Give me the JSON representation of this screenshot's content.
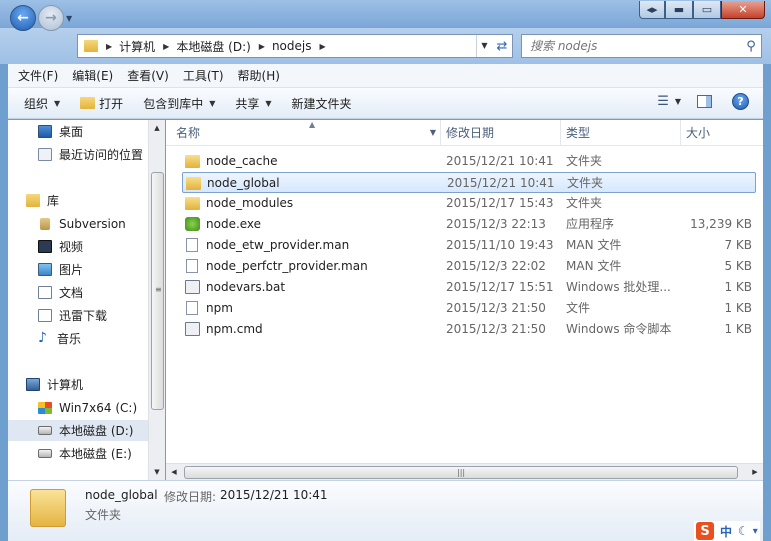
{
  "window": {
    "restore_label": "◂▸",
    "minimize_label": "▬",
    "maximize_label": "▭",
    "close_label": "✕"
  },
  "address": {
    "breadcrumbs": [
      "计算机",
      "本地磁盘 (D:)",
      "nodejs"
    ]
  },
  "search": {
    "placeholder": "搜索 nodejs"
  },
  "menu": [
    "文件(F)",
    "编辑(E)",
    "查看(V)",
    "工具(T)",
    "帮助(H)"
  ],
  "toolbar": {
    "organize": "组织",
    "open": "打开",
    "include_library": "包含到库中",
    "share": "共享",
    "new_folder": "新建文件夹"
  },
  "nav": {
    "favorites": [
      {
        "label": "桌面",
        "icon": "desktop-icon"
      },
      {
        "label": "最近访问的位置",
        "icon": "recent-places-icon"
      }
    ],
    "libraries_label": "库",
    "libraries": [
      {
        "label": "Subversion",
        "icon": "subversion-icon"
      },
      {
        "label": "视频",
        "icon": "video-icon"
      },
      {
        "label": "图片",
        "icon": "pictures-icon"
      },
      {
        "label": "文档",
        "icon": "documents-icon"
      },
      {
        "label": "迅雷下载",
        "icon": "thunder-download-icon"
      },
      {
        "label": "音乐",
        "icon": "music-icon"
      }
    ],
    "computer_label": "计算机",
    "drives": [
      {
        "label": "Win7x64 (C:)",
        "icon": "windows-drive-icon"
      },
      {
        "label": "本地磁盘 (D:)",
        "icon": "drive-icon",
        "selected": true
      },
      {
        "label": "本地磁盘 (E:)",
        "icon": "drive-icon"
      }
    ]
  },
  "columns": {
    "name": "名称",
    "modified": "修改日期",
    "type": "类型",
    "size": "大小"
  },
  "files": [
    {
      "name": "node_cache",
      "modified": "2015/12/21 10:41",
      "type": "文件夹",
      "size": "",
      "kind": "folder"
    },
    {
      "name": "node_global",
      "modified": "2015/12/21 10:41",
      "type": "文件夹",
      "size": "",
      "kind": "folder",
      "selected": true
    },
    {
      "name": "node_modules",
      "modified": "2015/12/17 15:43",
      "type": "文件夹",
      "size": "",
      "kind": "folder"
    },
    {
      "name": "node.exe",
      "modified": "2015/12/3 22:13",
      "type": "应用程序",
      "size": "13,239 KB",
      "kind": "exe"
    },
    {
      "name": "node_etw_provider.man",
      "modified": "2015/11/10 19:43",
      "type": "MAN 文件",
      "size": "7 KB",
      "kind": "file"
    },
    {
      "name": "node_perfctr_provider.man",
      "modified": "2015/12/3 22:02",
      "type": "MAN 文件",
      "size": "5 KB",
      "kind": "file"
    },
    {
      "name": "nodevars.bat",
      "modified": "2015/12/17 15:51",
      "type": "Windows 批处理...",
      "size": "1 KB",
      "kind": "bat"
    },
    {
      "name": "npm",
      "modified": "2015/12/3 21:50",
      "type": "文件",
      "size": "1 KB",
      "kind": "file"
    },
    {
      "name": "npm.cmd",
      "modified": "2015/12/3 21:50",
      "type": "Windows 命令脚本",
      "size": "1 KB",
      "kind": "bat"
    }
  ],
  "details": {
    "name": "node_global",
    "modified_label": "修改日期:",
    "modified_value": "2015/12/21 10:41",
    "type": "文件夹"
  },
  "ime": {
    "logo": "S",
    "lang": "中"
  }
}
